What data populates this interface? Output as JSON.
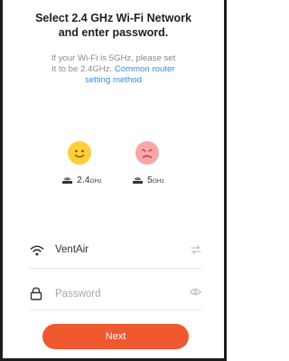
{
  "header": {
    "title_line1": "Select 2.4 GHz Wi-Fi Network",
    "title_line2": "and enter password.",
    "subtitle_line1": "If your Wi-Fi is 5GHz, please set",
    "subtitle_line2_prefix": "it to be 2.4GHz.",
    "subtitle_link_part1": "Common router",
    "subtitle_link_part2": "setting method"
  },
  "bands": {
    "supported": {
      "icon": "happy-face-icon",
      "label_main": "2.4",
      "label_unit": "GHz",
      "color": "#ffce3a"
    },
    "unsupported": {
      "icon": "sad-face-icon",
      "label_main": "5",
      "label_unit": "GHz",
      "color": "#f9a6a6"
    }
  },
  "form": {
    "ssid": {
      "icon": "wifi-icon",
      "value": "VentAir",
      "trailing_icon": "switch-network-icon"
    },
    "password": {
      "icon": "lock-icon",
      "placeholder": "Password",
      "value": "",
      "trailing_icon": "eye-icon"
    }
  },
  "actions": {
    "next_label": "Next",
    "next_color": "#f0582f"
  }
}
